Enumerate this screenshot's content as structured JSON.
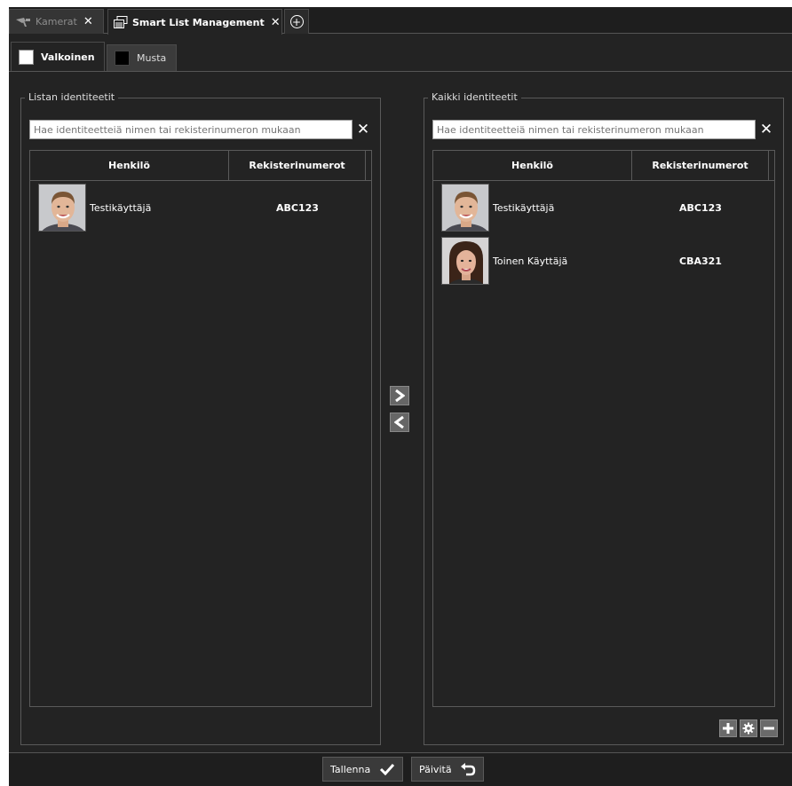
{
  "tabs": [
    {
      "label": "Kamerat",
      "icon": "camera-icon"
    },
    {
      "label": "Smart List Management",
      "icon": "window-list-icon"
    }
  ],
  "subtabs": [
    {
      "label": "Valkoinen",
      "color": "#ffffff"
    },
    {
      "label": "Musta",
      "color": "#000000"
    }
  ],
  "left_panel": {
    "title": "Listan identiteetit",
    "search_placeholder": "Hae identiteetteiä nimen tai rekisterinumeron mukaan",
    "columns": [
      "Henkilö",
      "Rekisterinumerot"
    ],
    "rows": [
      {
        "name": "Testikäyttäjä",
        "reg": "ABC123",
        "avatar": "male-face-photo"
      }
    ]
  },
  "right_panel": {
    "title": "Kaikki identiteetit",
    "search_placeholder": "Hae identiteetteiä nimen tai rekisterinumeron mukaan",
    "columns": [
      "Henkilö",
      "Rekisterinumerot"
    ],
    "rows": [
      {
        "name": "Testikäyttäjä",
        "reg": "ABC123",
        "avatar": "male-face-photo"
      },
      {
        "name": "Toinen Käyttäjä",
        "reg": "CBA321",
        "avatar": "female-face-photo"
      }
    ]
  },
  "buttons": {
    "save": "Tallenna",
    "refresh": "Päivitä"
  },
  "colors": {
    "background": "#232323",
    "border": "#5a5a5a",
    "button": "#666666"
  }
}
